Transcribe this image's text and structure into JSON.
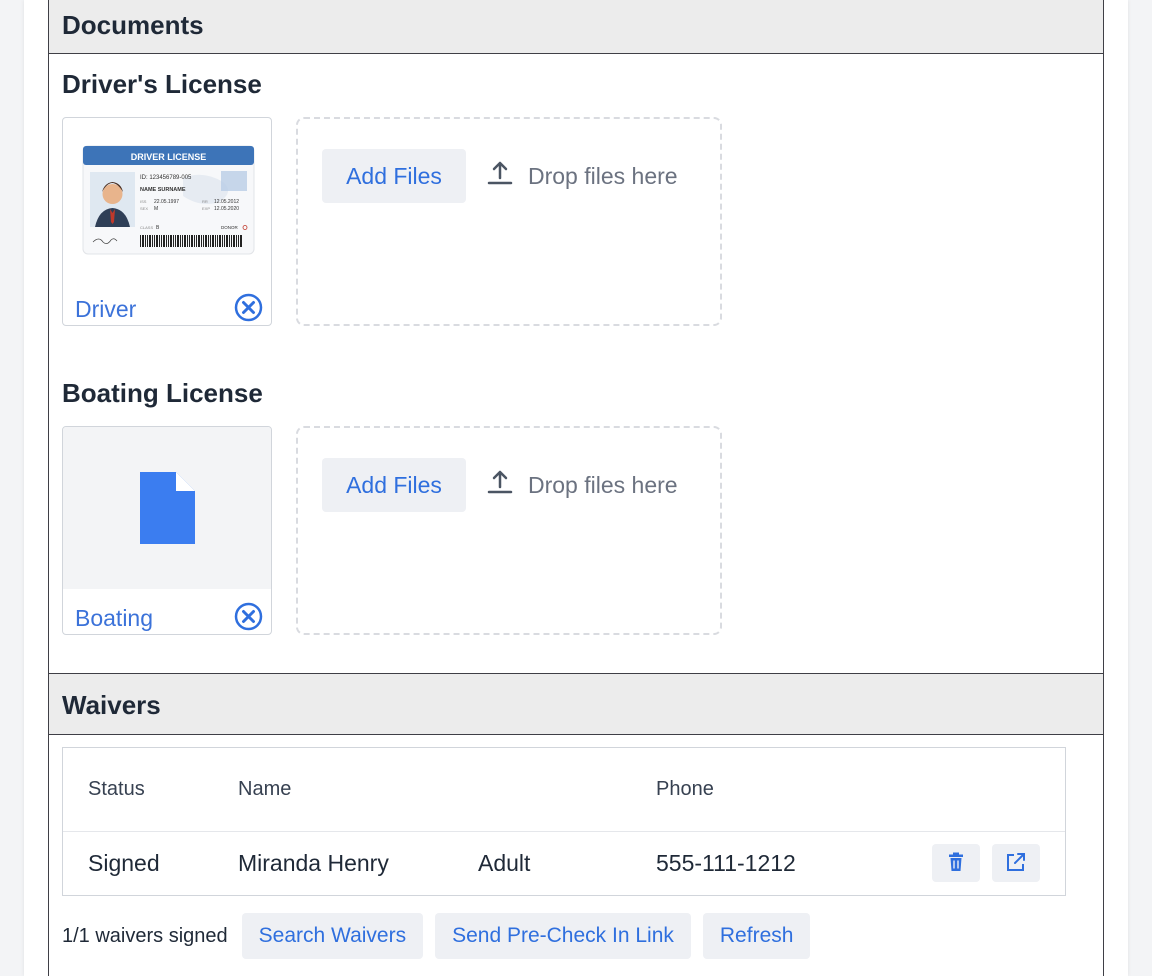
{
  "documents": {
    "header": "Documents",
    "groups": [
      {
        "title": "Driver's License",
        "file_caption": "Driver",
        "card_text": {
          "heading": "DRIVER LICENSE",
          "id_line": "ID: 123456789-005",
          "name_line": "NAME SURNAME",
          "iss_label": "ISS",
          "iss_value": "22.05.1997",
          "sex_label": "SEX",
          "sex_value": "M",
          "rr_label": "RR",
          "rr_value": "12.05.2012",
          "exp_label": "EXP",
          "exp_value": "12.05.2020",
          "class_label": "CLASS",
          "class_value": "B",
          "donor_label": "DONOR"
        },
        "add_files_label": "Add Files",
        "drop_hint": "Drop files here"
      },
      {
        "title": "Boating License",
        "file_caption": "Boating",
        "add_files_label": "Add Files",
        "drop_hint": "Drop files here"
      }
    ]
  },
  "waivers": {
    "header": "Waivers",
    "columns": [
      "Status",
      "Name",
      "Phone"
    ],
    "rows": [
      {
        "status": "Signed",
        "name": "Miranda Henry",
        "type": "Adult",
        "phone": "555-111-1212"
      }
    ],
    "summary": "1/1 waivers signed",
    "buttons": {
      "search": "Search Waivers",
      "send_link": "Send Pre-Check In Link",
      "refresh": "Refresh"
    }
  },
  "colors": {
    "accent": "#2f6fde",
    "file_icon": "#3b7df0",
    "header_bg": "#ececec"
  }
}
